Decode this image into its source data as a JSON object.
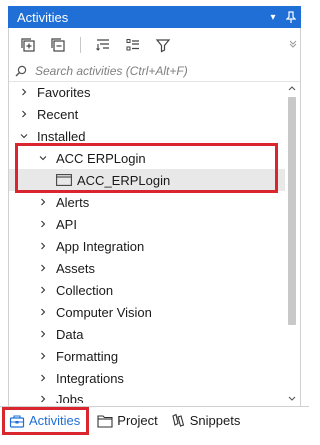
{
  "panel": {
    "title": "Activities",
    "dropdown_glyph": "▾",
    "pin_glyph": "⊥"
  },
  "toolbar": {
    "buttons": [
      {
        "name": "expand-all-icon"
      },
      {
        "name": "collapse-all-icon"
      },
      {
        "name": "sort-icon"
      },
      {
        "name": "group-icon"
      },
      {
        "name": "filter-icon"
      }
    ]
  },
  "search": {
    "placeholder": "Search activities (Ctrl+Alt+F)"
  },
  "tree": {
    "favorites": "Favorites",
    "recent": "Recent",
    "installed": "Installed",
    "acc_erplogin": "ACC ERPLogin",
    "acc_erplogin_activity": "ACC_ERPLogin",
    "alerts": "Alerts",
    "api": "API",
    "app_integration": "App Integration",
    "assets": "Assets",
    "collection": "Collection",
    "computer_vision": "Computer Vision",
    "data": "Data",
    "formatting": "Formatting",
    "integrations": "Integrations",
    "jobs": "Jobs"
  },
  "bottom_tabs": {
    "activities": "Activities",
    "project": "Project",
    "snippets": "Snippets"
  },
  "colors": {
    "accent": "#1f6fd6",
    "highlight": "#d9252d"
  }
}
